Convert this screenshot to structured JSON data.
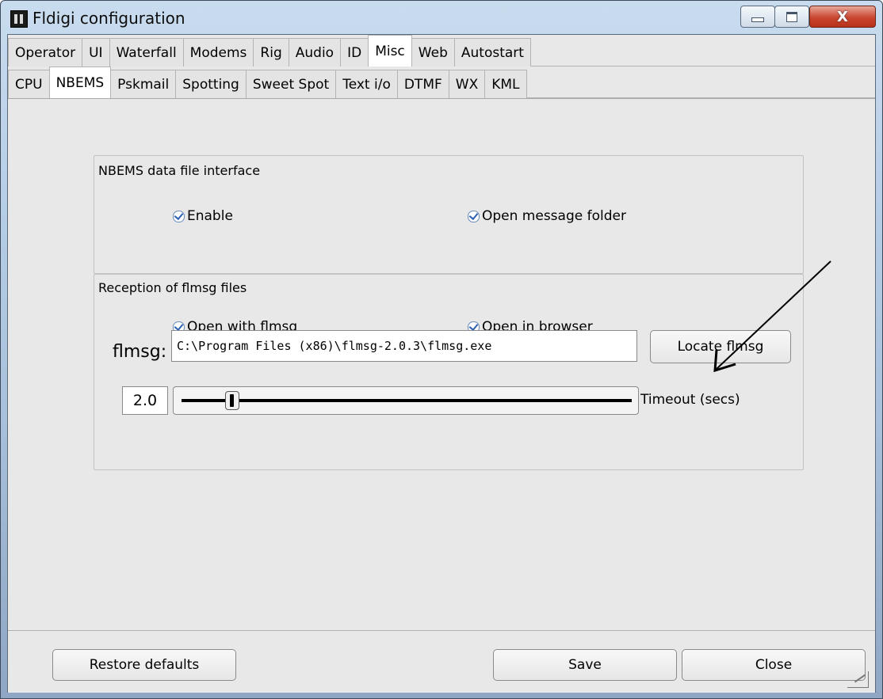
{
  "window": {
    "title": "Fldigi configuration",
    "close_glyph": "X"
  },
  "main_tabs": [
    {
      "label": "Operator",
      "selected": false
    },
    {
      "label": "UI",
      "selected": false
    },
    {
      "label": "Waterfall",
      "selected": false
    },
    {
      "label": "Modems",
      "selected": false
    },
    {
      "label": "Rig",
      "selected": false
    },
    {
      "label": "Audio",
      "selected": false
    },
    {
      "label": "ID",
      "selected": false
    },
    {
      "label": "Misc",
      "selected": true
    },
    {
      "label": "Web",
      "selected": false
    },
    {
      "label": "Autostart",
      "selected": false
    }
  ],
  "sub_tabs": [
    {
      "label": "CPU",
      "selected": false
    },
    {
      "label": "NBEMS",
      "selected": true
    },
    {
      "label": "Pskmail",
      "selected": false
    },
    {
      "label": "Spotting",
      "selected": false
    },
    {
      "label": "Sweet Spot",
      "selected": false
    },
    {
      "label": "Text i/o",
      "selected": false
    },
    {
      "label": "DTMF",
      "selected": false
    },
    {
      "label": "WX",
      "selected": false
    },
    {
      "label": "KML",
      "selected": false
    }
  ],
  "nbems_group": {
    "label": "NBEMS data file interface",
    "enable": {
      "label": "Enable",
      "checked": true
    },
    "open_folder": {
      "label": "Open message folder",
      "checked": true
    }
  },
  "reception_group": {
    "label": "Reception of flmsg files",
    "open_with_flmsg": {
      "label": "Open with flmsg",
      "checked": true
    },
    "open_in_browser": {
      "label": "Open in browser",
      "checked": true
    },
    "flmsg_label": "flmsg:",
    "flmsg_path": "C:\\Program Files (x86)\\flmsg-2.0.3\\flmsg.exe",
    "locate_button": "Locate flmsg",
    "timeout_value": "2.0",
    "timeout_fraction": 0.1,
    "timeout_label": "Timeout (secs)"
  },
  "bottom": {
    "restore_button": "Restore defaults",
    "save_button": "Save",
    "close_button": "Close"
  },
  "icons": {
    "app": "fldigi-app-icon",
    "checkbox": "check-icon",
    "annotation": "arrow-icon",
    "resize": "resize-grip-icon"
  }
}
